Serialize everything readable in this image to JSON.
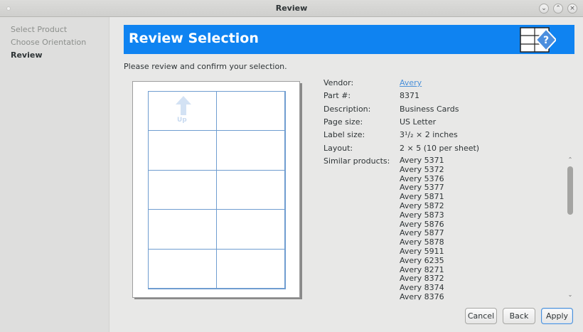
{
  "window": {
    "title": "Review",
    "controls": [
      "chevron-down-icon",
      "chevron-up-icon",
      "close-icon"
    ]
  },
  "sidebar": {
    "steps": [
      {
        "label": "Select Product",
        "active": false
      },
      {
        "label": "Choose Orientation",
        "active": false
      },
      {
        "label": "Review",
        "active": true
      }
    ]
  },
  "banner": {
    "title": "Review Selection",
    "color": "#0f83f1",
    "icon": "label-help-icon"
  },
  "intro": "Please review and confirm your selection.",
  "preview": {
    "columns": 2,
    "rows": 5,
    "orientation_label": "Up",
    "grid_color": "#6f9dd0"
  },
  "details": [
    {
      "key": "Vendor:",
      "value": "Avery",
      "link": true
    },
    {
      "key": "Part #:",
      "value": "8371"
    },
    {
      "key": "Description:",
      "value": "Business Cards"
    },
    {
      "key": "Page size:",
      "value": "US Letter"
    },
    {
      "key": "Label size:",
      "value": "3¹/₂ × 2 inches"
    },
    {
      "key": "Layout:",
      "value": "2 × 5 (10 per sheet)"
    },
    {
      "key": "Similar products:",
      "value": ""
    }
  ],
  "similar_products": [
    "Avery 5371",
    "Avery 5372",
    "Avery 5376",
    "Avery 5377",
    "Avery 5871",
    "Avery 5872",
    "Avery 5873",
    "Avery 5876",
    "Avery 5877",
    "Avery 5878",
    "Avery 5911",
    "Avery 6235",
    "Avery 8271",
    "Avery 8372",
    "Avery 8374",
    "Avery 8376"
  ],
  "buttons": {
    "cancel": "Cancel",
    "back": "Back",
    "apply": "Apply"
  }
}
